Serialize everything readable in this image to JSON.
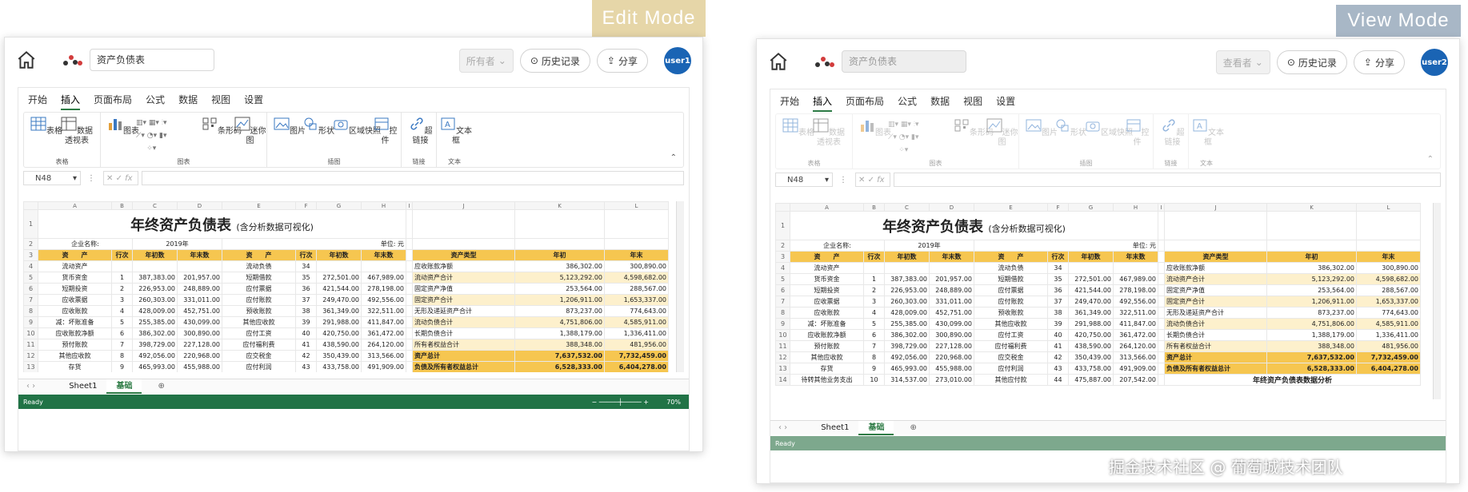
{
  "badges": {
    "edit": "Edit Mode",
    "view": "View Mode",
    "edit_color": "#e6d6a8",
    "view_color": "#a8b7c6"
  },
  "edit": {
    "doc_name": "资产负债表",
    "owner_dd": "所有者",
    "history": "历史记录",
    "share": "分享",
    "user": "user1",
    "zoom": "70%"
  },
  "view": {
    "doc_name": "资产负债表",
    "owner_dd": "查看者",
    "history": "历史记录",
    "share": "分享",
    "user": "user2"
  },
  "menu": [
    "开始",
    "插入",
    "页面布局",
    "公式",
    "数据",
    "视图",
    "设置"
  ],
  "ribbon": {
    "table": "表格",
    "pivot": "数据透视表",
    "chart": "图表",
    "barcode": "条形码",
    "sparkline": "迷你图",
    "picture": "图片",
    "shape": "形状",
    "snapshot": "区域快照",
    "control": "控件",
    "hyperlink": "超链接",
    "textbox": "文本框",
    "groups": [
      "表格",
      "图表",
      "插图",
      "链接",
      "文本"
    ]
  },
  "formula": {
    "cell": "N48",
    "fx": "fx"
  },
  "sheet": {
    "cols": [
      "A",
      "B",
      "C",
      "D",
      "E",
      "F",
      "G",
      "H",
      "I",
      "J",
      "K",
      "L"
    ],
    "title": "年终资产负债表",
    "subtitle": "(含分析数据可视化)",
    "company_label": "企业名称:",
    "year": "2019年",
    "unit": "单位: 元",
    "headers": [
      "资　　产",
      "行次",
      "年初数",
      "年末数",
      "资　　产",
      "行次",
      "年初数",
      "年末数"
    ],
    "right_headers": [
      "资产类型",
      "年初",
      "年末"
    ],
    "rows": [
      [
        "流动资产",
        "",
        "",
        "",
        "流动负债",
        "34",
        "",
        ""
      ],
      [
        "货币资金",
        "1",
        "387,383.00",
        "201,957.00",
        "短期借款",
        "35",
        "272,501.00",
        "467,989.00"
      ],
      [
        "短期投资",
        "2",
        "226,953.00",
        "248,889.00",
        "应付票据",
        "36",
        "421,544.00",
        "278,198.00"
      ],
      [
        "应收票据",
        "3",
        "260,303.00",
        "331,011.00",
        "应付账款",
        "37",
        "249,470.00",
        "492,556.00"
      ],
      [
        "应收账款",
        "4",
        "428,009.00",
        "452,751.00",
        "预收账款",
        "38",
        "361,349.00",
        "322,511.00"
      ],
      [
        "减：坏账准备",
        "5",
        "255,385.00",
        "430,099.00",
        "其他应收款",
        "39",
        "291,988.00",
        "411,847.00"
      ],
      [
        "应收账款净额",
        "6",
        "386,302.00",
        "300,890.00",
        "应付工资",
        "40",
        "420,750.00",
        "361,472.00"
      ],
      [
        "预付账款",
        "7",
        "398,729.00",
        "227,128.00",
        "应付福利费",
        "41",
        "438,590.00",
        "264,120.00"
      ],
      [
        "其他应收款",
        "8",
        "492,056.00",
        "220,968.00",
        "应交税金",
        "42",
        "350,439.00",
        "313,566.00"
      ],
      [
        "存货",
        "9",
        "465,993.00",
        "455,988.00",
        "应付利润",
        "43",
        "433,758.00",
        "491,909.00"
      ],
      [
        "待转其他业务支出",
        "10",
        "314,537.00",
        "273,010.00",
        "其他应付款",
        "44",
        "475,887.00",
        "207,542.00"
      ]
    ],
    "right_rows": [
      [
        "应收账款净额",
        "386,302.00",
        "300,890.00"
      ],
      [
        "流动资产合计",
        "5,123,292.00",
        "4,598,682.00"
      ],
      [
        "固定资产净值",
        "253,564.00",
        "288,567.00"
      ],
      [
        "固定资产合计",
        "1,206,911.00",
        "1,653,337.00"
      ],
      [
        "无形及递延资产合计",
        "873,237.00",
        "774,643.00"
      ],
      [
        "流动负债合计",
        "4,751,806.00",
        "4,585,911.00"
      ],
      [
        "长期负债合计",
        "1,388,179.00",
        "1,336,411.00"
      ],
      [
        "所有者权益合计",
        "388,348.00",
        "481,956.00"
      ],
      [
        "资产总计",
        "7,637,532.00",
        "7,732,459.00"
      ],
      [
        "负债及所有者权益总计",
        "6,528,333.00",
        "6,404,278.00"
      ]
    ],
    "analysis_title": "年终资产负债表数据分析"
  },
  "tabs": {
    "sheet1": "Sheet1",
    "base": "基础"
  },
  "status": "Ready",
  "watermark": "掘金技术社区 @ 葡萄城技术团队"
}
